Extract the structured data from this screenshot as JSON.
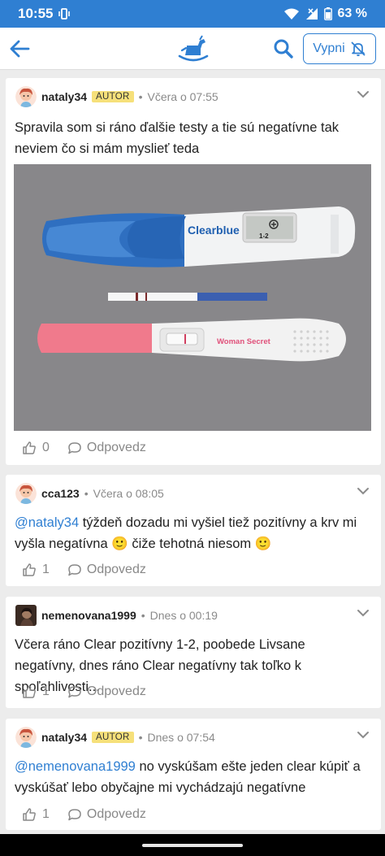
{
  "status_bar": {
    "time": "10:55",
    "battery": "63 %",
    "icons": [
      "vibrate-icon",
      "wifi-icon",
      "signal-icon",
      "battery-icon"
    ]
  },
  "app_bar": {
    "mute_label": "Vypni",
    "icons": [
      "back-arrow-icon",
      "rocking-horse-logo",
      "search-icon",
      "bell-off-icon"
    ],
    "accent": "#2f7fd2"
  },
  "posts": [
    {
      "author": "nataly34",
      "badge": "AUTOR",
      "time": "Včera o 07:55",
      "text": "Spravila som si ráno ďalšie testy a tie sú negatívne tak neviem čo si mám myslieť teda",
      "photo": {
        "brand_top": "Clearblue",
        "display": "1-2",
        "brand_bottom": "Woman Secret"
      },
      "likes": "0",
      "reply_label": "Odpovedz"
    },
    {
      "author": "cca123",
      "time": "Včera o 08:05",
      "mention": "@nataly34",
      "text": " týždeň dozadu mi vyšiel tiež pozitívny a krv mi vyšla negatívna 🙂 čiže tehotná niesom 🙂",
      "likes": "1",
      "reply_label": "Odpovedz"
    },
    {
      "author": "nemenovana1999",
      "time": "Dnes o 00:19",
      "text": "Včera ráno Clear pozitívny 1-2, poobede Livsane negatívny, dnes ráno Clear negatívny tak toľko k spoľahlivosti...",
      "likes": "1",
      "reply_label": "Odpovedz"
    },
    {
      "author": "nataly34",
      "badge": "AUTOR",
      "time": "Dnes o 07:54",
      "mention": "@nemenovana1999",
      "text": " no vyskúšam ešte jeden clear kúpiť a vyskúšať lebo obyčajne mi vychádzajú negatívne",
      "likes": "1",
      "reply_label": "Odpovedz"
    }
  ],
  "colors": {
    "status_bar": "#2f7fd2",
    "badge": "#f6e07a",
    "meta": "#8a8a8a"
  }
}
